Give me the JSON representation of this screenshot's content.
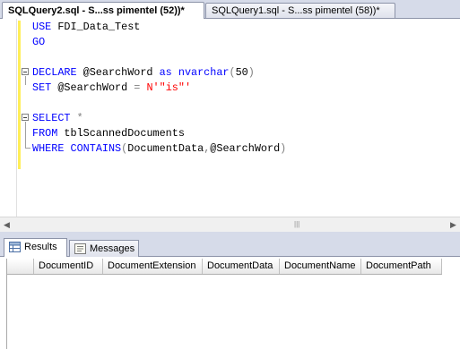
{
  "tabs": [
    {
      "label": "SQLQuery2.sql - S...ss pimentel (52))*",
      "active": true
    },
    {
      "label": "SQLQuery1.sql - S...ss pimentel (58))*",
      "active": false
    }
  ],
  "editor": {
    "lines": [
      {
        "parts": [
          {
            "t": "USE",
            "c": "kw"
          },
          {
            "t": " FDI_Data_Test",
            "c": ""
          }
        ]
      },
      {
        "parts": [
          {
            "t": "GO",
            "c": "kw"
          }
        ]
      },
      {
        "parts": []
      },
      {
        "parts": [
          {
            "t": "DECLARE",
            "c": "kw"
          },
          {
            "t": " @SearchWord ",
            "c": ""
          },
          {
            "t": "as",
            "c": "kw"
          },
          {
            "t": " ",
            "c": ""
          },
          {
            "t": "nvarchar",
            "c": "kw"
          },
          {
            "t": "(",
            "c": "gray"
          },
          {
            "t": "50",
            "c": ""
          },
          {
            "t": ")",
            "c": "gray"
          }
        ]
      },
      {
        "parts": [
          {
            "t": "SET",
            "c": "kw"
          },
          {
            "t": " @SearchWord ",
            "c": ""
          },
          {
            "t": "=",
            "c": "gray"
          },
          {
            "t": " ",
            "c": ""
          },
          {
            "t": "N'\"is\"'",
            "c": "str"
          }
        ]
      },
      {
        "parts": []
      },
      {
        "parts": [
          {
            "t": "SELECT",
            "c": "kw"
          },
          {
            "t": " ",
            "c": ""
          },
          {
            "t": "*",
            "c": "gray"
          }
        ]
      },
      {
        "parts": [
          {
            "t": "FROM",
            "c": "kw"
          },
          {
            "t": " tblScannedDocuments",
            "c": ""
          }
        ]
      },
      {
        "parts": [
          {
            "t": "WHERE",
            "c": "kw"
          },
          {
            "t": " ",
            "c": ""
          },
          {
            "t": "CONTAINS",
            "c": "kw"
          },
          {
            "t": "(",
            "c": "gray"
          },
          {
            "t": "DocumentData",
            "c": ""
          },
          {
            "t": ",",
            "c": "gray"
          },
          {
            "t": "@SearchWord",
            "c": ""
          },
          {
            "t": ")",
            "c": "gray"
          }
        ]
      }
    ]
  },
  "results_tabs": [
    {
      "label": "Results",
      "icon": "grid-icon",
      "active": true
    },
    {
      "label": "Messages",
      "icon": "messages-icon",
      "active": false
    }
  ],
  "grid": {
    "columns": [
      "DocumentID",
      "DocumentExtension",
      "DocumentData",
      "DocumentName",
      "DocumentPath"
    ]
  },
  "colors": {
    "keyword": "#0000ff",
    "string": "#ff0000",
    "operator": "#808080",
    "changebar": "#ffee58"
  }
}
